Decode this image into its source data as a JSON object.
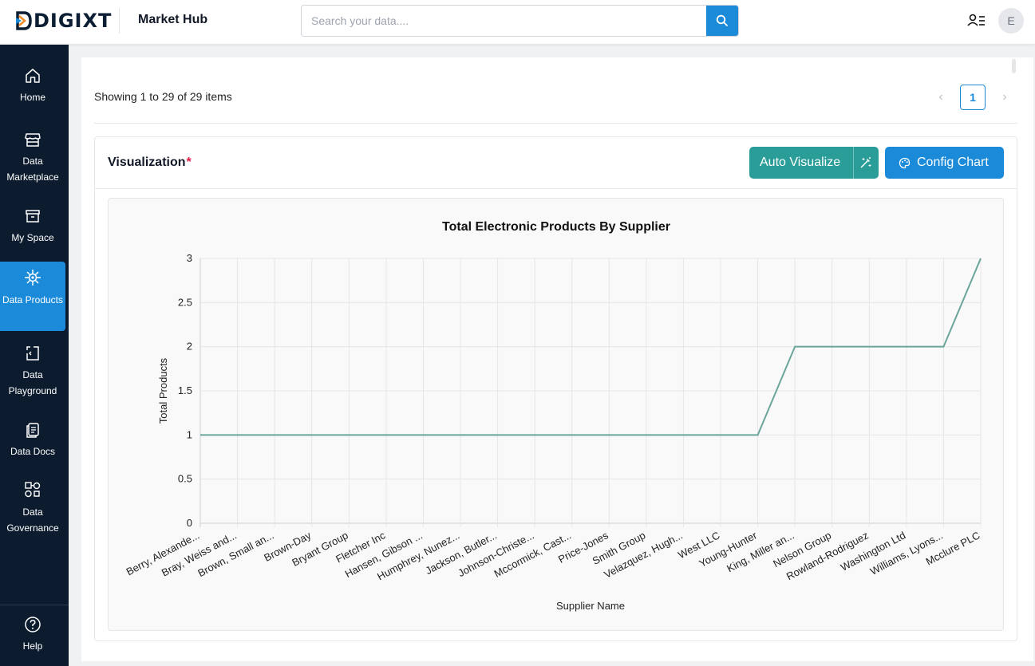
{
  "header": {
    "logo_text": "DIGIXT",
    "app_title": "Market Hub",
    "search_placeholder": "Search your data...."
  },
  "user": {
    "avatar_initial": "E"
  },
  "sidebar": {
    "items": [
      {
        "label": "Home",
        "icon": "home-icon",
        "active": false
      },
      {
        "label": "Data Marketplace",
        "icon": "store-icon",
        "active": false
      },
      {
        "label": "My Space",
        "icon": "archive-box-icon",
        "active": false
      },
      {
        "label": "Data Products",
        "icon": "hub-icon",
        "active": true
      },
      {
        "label": "Data Playground",
        "icon": "playground-icon",
        "active": false
      },
      {
        "label": "Data Docs",
        "icon": "docs-icon",
        "active": false
      },
      {
        "label": "Data Governance",
        "icon": "governance-icon",
        "active": false
      }
    ],
    "help_label": "Help"
  },
  "pagination": {
    "showing_text": "Showing 1 to 29 of 29 items",
    "current_page": "1",
    "prev_label": "‹",
    "next_label": "›"
  },
  "visualization": {
    "title": "Visualization",
    "required_mark": "*",
    "auto_visualize_label": "Auto Visualize",
    "config_chart_label": "Config Chart"
  },
  "colors": {
    "accent_blue": "#1b8ad8",
    "teal": "#2a9d98",
    "sidebar_bg": "#0c1c2e",
    "line": "#6aa59b"
  },
  "chart_data": {
    "type": "line",
    "title": "Total Electronic Products By Supplier",
    "xlabel": "Supplier Name",
    "ylabel": "Total Products",
    "ylim": [
      0,
      3
    ],
    "yticks": [
      "0",
      "0.5",
      "1",
      "1.5",
      "2",
      "2.5",
      "3"
    ],
    "grid": true,
    "categories": [
      "Berry, Alexande...",
      "Bray, Weiss and...",
      "Brown, Small an...",
      "Brown-Day",
      "Bryant Group",
      "Fletcher Inc",
      "Hansen, Gibson ...",
      "Humphrey, Nunez...",
      "Jackson, Butler...",
      "Johnson-Christe...",
      "Mccormick, Cast...",
      "Price-Jones",
      "Smith Group",
      "Velazquez, Hugh...",
      "West LLC",
      "Young-Hunter",
      "King, Miller an...",
      "Nelson Group",
      "Rowland-Rodriguez",
      "Washington Ltd",
      "Williams, Lyons...",
      "Mcclure PLC"
    ],
    "values": [
      1,
      1,
      1,
      1,
      1,
      1,
      1,
      1,
      1,
      1,
      1,
      1,
      1,
      1,
      1,
      1,
      2,
      2,
      2,
      2,
      2,
      3
    ]
  }
}
